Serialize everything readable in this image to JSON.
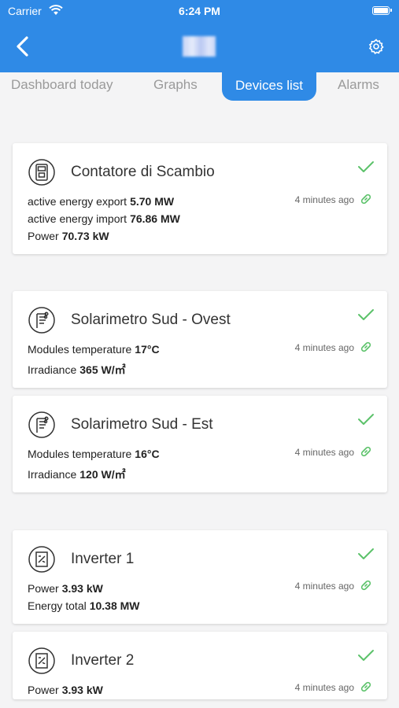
{
  "status_bar": {
    "carrier": "Carrier",
    "time": "6:24 PM"
  },
  "tabs": [
    {
      "label": "Dashboard today"
    },
    {
      "label": "Graphs"
    },
    {
      "label": "Devices list"
    },
    {
      "label": "Alarms"
    }
  ],
  "active_tab": "Devices list",
  "colors": {
    "primary": "#2f8ae6",
    "ok_green": "#5cc26a"
  },
  "devices": [
    {
      "name": "Contatore di Scambio",
      "icon": "meter-icon",
      "updated": "4 minutes ago",
      "status": "ok",
      "metrics": [
        {
          "label": "active energy export",
          "value": "5.70 MW"
        },
        {
          "label": "active energy import",
          "value": "76.86 MW"
        },
        {
          "label": "Power",
          "value": "70.73 kW"
        }
      ]
    },
    {
      "name": "Solarimetro Sud - Ovest",
      "icon": "solarimeter-icon",
      "updated": "4 minutes ago",
      "status": "ok",
      "metrics": [
        {
          "label": "Modules temperature",
          "value": "17°C"
        },
        {
          "label": "Irradiance",
          "value": "365 W/㎡"
        }
      ]
    },
    {
      "name": "Solarimetro Sud - Est",
      "icon": "solarimeter-icon",
      "updated": "4 minutes ago",
      "status": "ok",
      "metrics": [
        {
          "label": "Modules temperature",
          "value": "16°C"
        },
        {
          "label": "Irradiance",
          "value": "120 W/㎡"
        }
      ]
    },
    {
      "name": "Inverter 1",
      "icon": "inverter-icon",
      "updated": "4 minutes ago",
      "status": "ok",
      "metrics": [
        {
          "label": "Power",
          "value": "3.93 kW"
        },
        {
          "label": "Energy total",
          "value": "10.38 MW"
        }
      ]
    },
    {
      "name": "Inverter 2",
      "icon": "inverter-icon",
      "updated": "4 minutes ago",
      "status": "ok",
      "metrics": [
        {
          "label": "Power",
          "value": "3.93 kW"
        }
      ]
    }
  ]
}
